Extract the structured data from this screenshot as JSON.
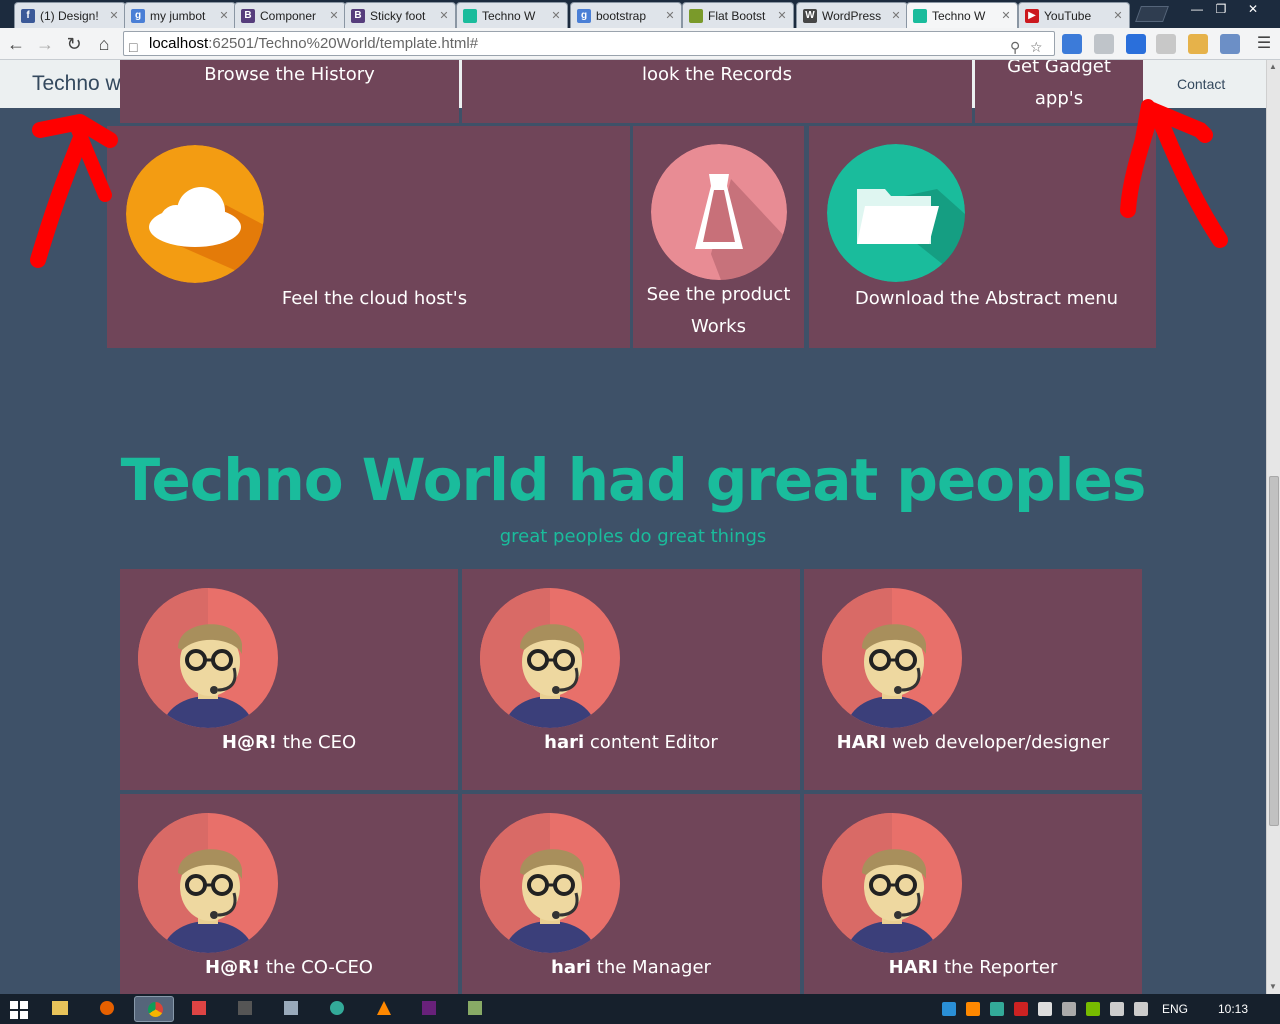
{
  "browser": {
    "tabs": [
      {
        "title": "(1) Design!",
        "favicon": "facebook-icon",
        "color": "#3b5998",
        "glyph": "f"
      },
      {
        "title": "my jumbot",
        "favicon": "google-icon",
        "color": "#4a7fd6",
        "glyph": "g"
      },
      {
        "title": "Componer",
        "favicon": "bootstrap-icon",
        "color": "#563d7c",
        "glyph": "B"
      },
      {
        "title": "Sticky foot",
        "favicon": "bootstrap-icon",
        "color": "#563d7c",
        "glyph": "B"
      },
      {
        "title": "Techno W",
        "favicon": "flat-ui-icon",
        "color": "#1abc9c",
        "glyph": ""
      },
      {
        "title": "bootstrap",
        "favicon": "google-icon",
        "color": "#4a7fd6",
        "glyph": "g"
      },
      {
        "title": "Flat Bootst",
        "favicon": "puzzle-icon",
        "color": "#7a9a2a",
        "glyph": ""
      },
      {
        "title": "WordPress",
        "favicon": "wordpress-icon",
        "color": "#464646",
        "glyph": "W"
      },
      {
        "title": "Techno W",
        "favicon": "flat-ui-icon",
        "color": "#1abc9c",
        "glyph": "",
        "active": true
      },
      {
        "title": "YouTube",
        "favicon": "youtube-icon",
        "color": "#cc181e",
        "glyph": "▶"
      }
    ],
    "url_host": "localhost",
    "url_rest": ":62501/Techno%20World/template.html#"
  },
  "navbar": {
    "brand": "Techno w",
    "contact": "Contact"
  },
  "menu": {
    "history": "Browse the History",
    "records": "look the Records",
    "gadget_line1": "Get Gadget",
    "gadget_line2": "app's"
  },
  "features": {
    "cloud": "Feel the cloud host's",
    "product_line1": "See the product",
    "product_line2": "Works",
    "abstract": "Download the Abstract menu"
  },
  "hero": {
    "title": "Techno World had great peoples",
    "subtitle": "great peoples do great things"
  },
  "team": [
    {
      "name": "H@R!",
      "role": "the CEO"
    },
    {
      "name": "hari",
      "role": "content Editor"
    },
    {
      "name": "HARI",
      "role": "web developer/designer"
    },
    {
      "name": "H@R!",
      "role": "the CO-CEO"
    },
    {
      "name": "hari",
      "role": "the Manager"
    },
    {
      "name": "HARI",
      "role": "the Reporter"
    }
  ],
  "taskbar": {
    "language": "ENG",
    "clock": "10:13"
  },
  "colors": {
    "background": "#3e5168",
    "tile": "#704559",
    "accent": "#1abc9c",
    "annotation_arrow": "#ff0000"
  }
}
